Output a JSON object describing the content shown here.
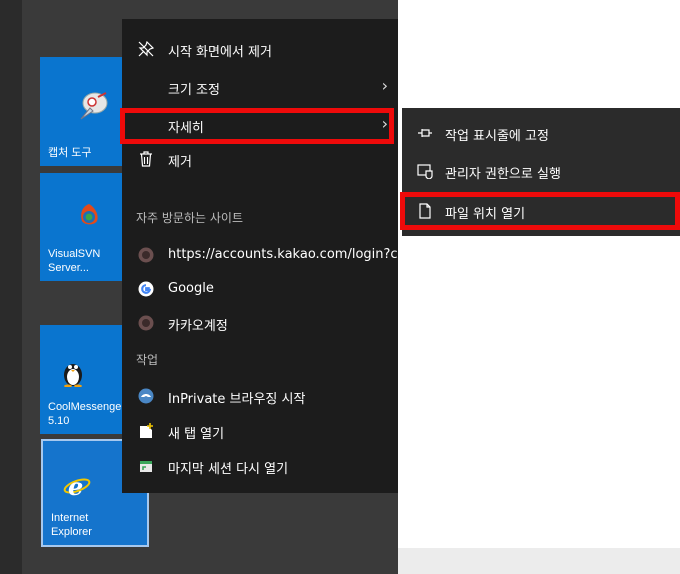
{
  "tiles": [
    {
      "id": "snip",
      "label": "캡처 도구"
    },
    {
      "id": "svn",
      "label": "VisualSVN\nServer..."
    },
    {
      "id": "cool",
      "label": "CoolMessenger\n5.10"
    },
    {
      "id": "ie",
      "label": "Internet\nExplorer"
    }
  ],
  "context_menu": {
    "items": [
      {
        "label": "시작 화면에서 제거",
        "icon": "unpin-icon"
      },
      {
        "label": "크기 조정",
        "chevron": "›"
      },
      {
        "label": "자세히",
        "chevron": "›"
      },
      {
        "label": "제거",
        "icon": "trash-icon"
      }
    ],
    "frequent_header": "자주 방문하는 사이트",
    "frequent": [
      {
        "label": "https://accounts.kakao.com/login?co...",
        "icon": "kakao-icon"
      },
      {
        "label": "Google",
        "icon": "google-icon"
      },
      {
        "label": "카카오계정",
        "icon": "kakao-icon"
      }
    ],
    "tasks_header": "작업",
    "tasks": [
      {
        "label": "InPrivate 브라우징 시작",
        "icon": "inprivate-icon"
      },
      {
        "label": "새 탭 열기",
        "icon": "new-tab-icon"
      },
      {
        "label": "마지막 세션 다시 열기",
        "icon": "reopen-session-icon"
      }
    ]
  },
  "sub_menu": {
    "items": [
      {
        "label": "작업 표시줄에 고정",
        "icon": "pin-taskbar-icon"
      },
      {
        "label": "관리자 권한으로 실행",
        "icon": "run-as-admin-icon"
      },
      {
        "label": "파일 위치 열기",
        "icon": "file-icon"
      }
    ]
  },
  "colors": {
    "tile_blue": "#0a75cf",
    "menu_bg": "#1c1c1c",
    "submenu_bg": "#2b2b2b",
    "highlight_red": "#ee0a0a"
  }
}
